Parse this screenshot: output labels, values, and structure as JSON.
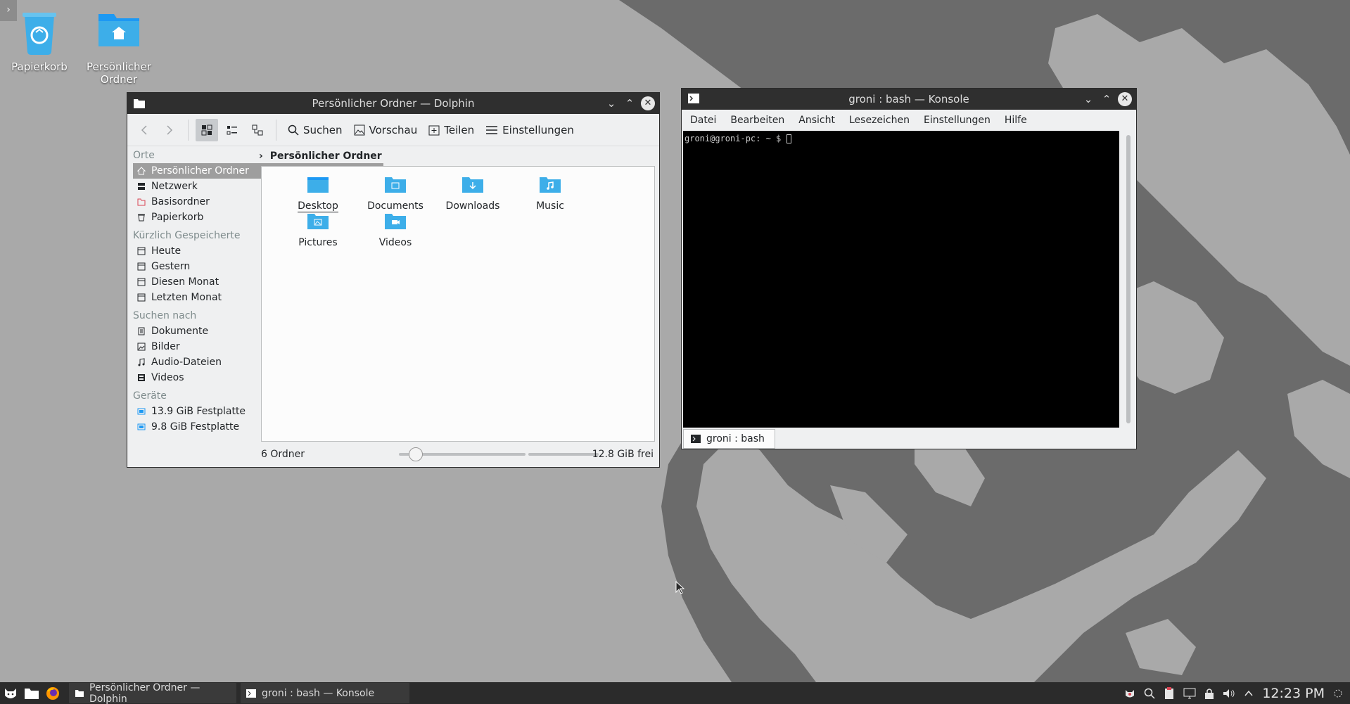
{
  "desktop": {
    "icons": [
      {
        "label": "Papierkorb",
        "icon": "trash-icon"
      },
      {
        "label": "Persönlicher Ordner",
        "icon": "home-folder-icon"
      }
    ],
    "corner_glyph": "›"
  },
  "dolphin": {
    "title": "Persönlicher Ordner — Dolphin",
    "toolbar": {
      "search": "Suchen",
      "preview": "Vorschau",
      "share": "Teilen",
      "settings": "Einstellungen"
    },
    "places": {
      "header_places": "Orte",
      "items_places": [
        "Persönlicher Ordner",
        "Netzwerk",
        "Basisordner",
        "Papierkorb"
      ],
      "header_recent": "Kürzlich Gespeicherte",
      "items_recent": [
        "Heute",
        "Gestern",
        "Diesen Monat",
        "Letzten Monat"
      ],
      "header_search": "Suchen nach",
      "items_search": [
        "Dokumente",
        "Bilder",
        "Audio-Dateien",
        "Videos"
      ],
      "header_devices": "Geräte",
      "items_devices": [
        "13.9 GiB Festplatte",
        "9.8 GiB Festplatte"
      ]
    },
    "breadcrumb": "Persönlicher Ordner",
    "files": [
      "Desktop",
      "Documents",
      "Downloads",
      "Music",
      "Pictures",
      "Videos"
    ],
    "status": {
      "count": "6 Ordner",
      "free": "12.8 GiB frei"
    },
    "colors": {
      "folder": "#3daee9",
      "selection": "#9e9e9e"
    }
  },
  "konsole": {
    "title": "groni : bash — Konsole",
    "menu": [
      "Datei",
      "Bearbeiten",
      "Ansicht",
      "Lesezeichen",
      "Einstellungen",
      "Hilfe"
    ],
    "prompt": "groni@groni-pc: ~ $ ",
    "tab": "groni : bash"
  },
  "taskbar": {
    "tasks": [
      "Persönlicher Ordner — Dolphin",
      "groni : bash — Konsole"
    ],
    "clock": "12:23 PM"
  }
}
